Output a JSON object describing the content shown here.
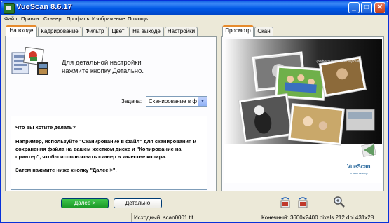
{
  "window": {
    "title": "VueScan 8.6.17",
    "minimize": "_",
    "maximize": "□",
    "close": "✕"
  },
  "menu": [
    "Файл",
    "Правка",
    "Сканер",
    "Профиль",
    "Изображение",
    "Помощь"
  ],
  "left_tabs": [
    "На входе",
    "Кадрирование",
    "Фильтр",
    "Цвет",
    "На выходе",
    "Настройки"
  ],
  "right_tabs": [
    "Просмотр",
    "Скан"
  ],
  "tip": {
    "line1": "Для детальной настройки",
    "line2": "нажмите кнопку Детально."
  },
  "task": {
    "label": "Задача:",
    "value": "Сканирование в ф"
  },
  "help": {
    "question": "Что вы хотите делать?",
    "example": "Например, используйте \"Сканирование в файл\" для сканирования и сохранения файла на вашем жестком диске и \"Копирование на принтер\", чтобы использовать сканер в качестве копира.",
    "next": "Затем нажмите ниже кнопку \"Далее >\"."
  },
  "buttons": {
    "next": "Далее >",
    "detail": "Детально"
  },
  "preview": {
    "caption": "Профессиональная версия",
    "brand": "VueScan",
    "tagline": "in ваш сканер"
  },
  "status": {
    "source": "Исходный: scan0001.tif",
    "output": "Конечный: 3600x2400 pixels 212 dpi 431x28"
  },
  "icons": {
    "rotate_left": "rotate-left-icon",
    "rotate_right": "rotate-right-icon",
    "zoom": "zoom-icon"
  },
  "colors": {
    "title_bar": "#0058e6",
    "tab_accent": "#e68b2c",
    "next_button": "#1c9a28"
  }
}
